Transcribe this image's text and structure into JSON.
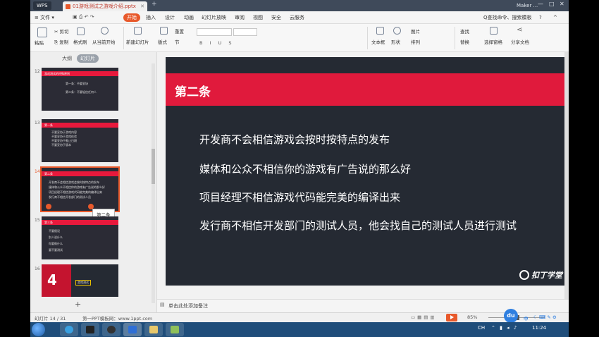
{
  "titlebar": {
    "app_name": "WPS",
    "doc_tab": "01游戏测试之游戏介绍.pptx",
    "plus": "+",
    "maker": "Maker ...",
    "controls": [
      "—",
      "□",
      "✕"
    ]
  },
  "menu": {
    "file": "≡ 文件 ▾",
    "items": [
      "开始",
      "插入",
      "设计",
      "动画",
      "幻灯片放映",
      "审阅",
      "视图",
      "安全",
      "云服务"
    ],
    "active_index": 0,
    "search_placeholder": "Q查找命令、搜索模板",
    "help": "?",
    "caret": "^"
  },
  "ribbon": {
    "paste": "粘贴",
    "cut": "剪切",
    "copy": "复制",
    "format_painter": "格式刷",
    "from_current": "从当前开始",
    "new_slide": "新建幻灯片",
    "layout": "版式",
    "reset": "重置",
    "section": "节",
    "font_tools": "B I U S",
    "textbox": "文本框",
    "shape": "形状",
    "picture": "图片",
    "arrange": "排列",
    "find": "查找",
    "replace": "替换",
    "select_pane": "选择窗格",
    "share": "分享文档"
  },
  "left_panel": {
    "tab_outline": "大纲",
    "tab_slides": "幻灯片",
    "add_slide": "+",
    "tooltip": "第二条",
    "thumbnails": [
      {
        "num": "12",
        "title": "游戏测试的特殊原则",
        "lines": [
          "第一条：不要妥协",
          "第二条：不要轻信任何人"
        ]
      },
      {
        "num": "13",
        "title": "第一条",
        "lines": [
          "不要妥协于游戏内容",
          "不要妥协于游戏体验",
          "不要妥协于截止日期",
          "不要妥协于版本"
        ]
      },
      {
        "num": "14",
        "title": "第二条",
        "lines": [
          "开发商不会相信游戏会按时按特点的发布",
          "媒体和公众不相信你的游戏有广告说的那么好",
          "项目经理不相信游戏代码能完美的编译出来",
          "发行商不相信开发部门的测试人员"
        ]
      },
      {
        "num": "15",
        "title": "第三条",
        "lines": [
          "不要假设",
          "别人说什么",
          "你要做什么",
          "要不要测试"
        ]
      },
      {
        "num": "16",
        "title": "",
        "lines": [
          "游戏测试"
        ]
      }
    ]
  },
  "slide": {
    "title": "第二条",
    "lines": [
      "开发商不会相信游戏会按时按特点的发布",
      "媒体和公众不相信你的游戏有广告说的那么好",
      "项目经理不相信游戏代码能完美的编译出来",
      "发行商不相信开发部门的测试人员，他会找自己的测试人员进行测试"
    ],
    "logo_text": "扣丁学堂",
    "thumb_number": "4"
  },
  "notes": {
    "placeholder": "单击此处添加备注"
  },
  "statusbar": {
    "slide_count": "幻灯片 14 / 31",
    "theme": "第一PPT模板网：www.1ppt.com",
    "zoom": "85%",
    "du": "du",
    "tray_lang": "中"
  },
  "taskbar": {
    "clock": "11:24",
    "tray_text": "CH"
  },
  "colors": {
    "accent": "#e8592b",
    "slide_red": "#e01a3c",
    "slide_bg": "#252a33",
    "titlebar": "#3f4a5a",
    "taskbar": "#1f4d7a"
  }
}
